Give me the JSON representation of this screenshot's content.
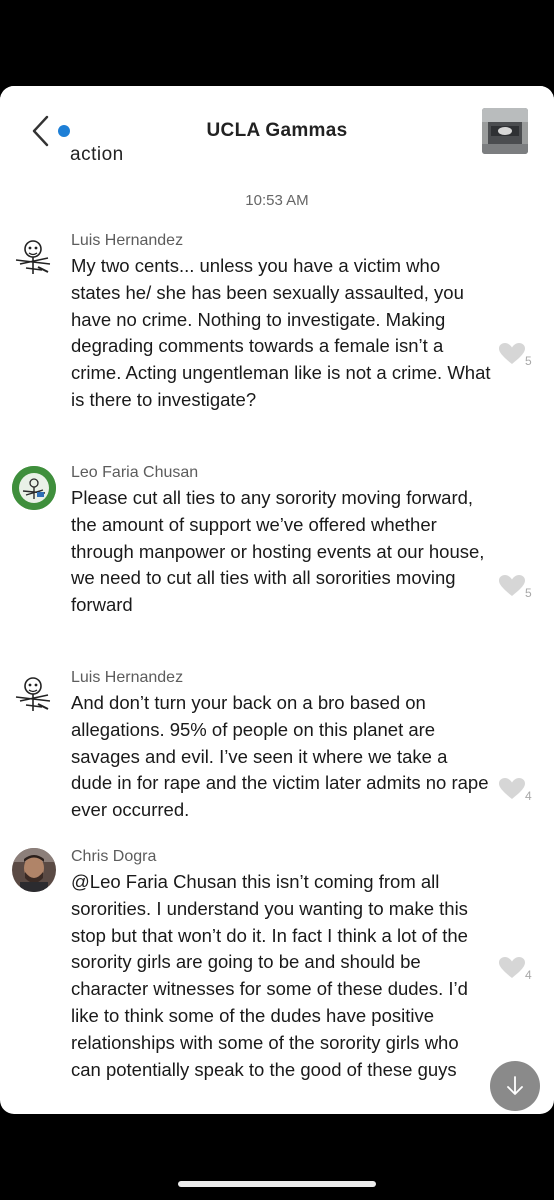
{
  "header": {
    "title": "UCLA Gammas",
    "back_icon": "chevron-left-icon",
    "unread_color": "#1e7fd6",
    "group_avatar": "group-photo"
  },
  "clipped_previous_text": "action",
  "timestamp": "10:53 AM",
  "messages": [
    {
      "sender": "Luis Hernandez",
      "text": "My two cents... unless you have a victim who states he/ she has been sexually assaulted, you have no crime. Nothing to investigate. Making degrading comments towards a female isn’t a crime. Acting ungentleman like is not a crime. What is there to investigate?",
      "likes": "5",
      "avatar": "cartoon-meme-avatar"
    },
    {
      "sender": "Leo Faria Chusan",
      "text": "Please cut all ties to any sorority moving forward, the amount of support we’ve offered whether through manpower or hosting events at our house, we need to cut all ties with all sororities moving forward",
      "likes": "5",
      "avatar": "green-cartoon-avatar"
    },
    {
      "sender": "Luis Hernandez",
      "text": "And don’t turn your back on a bro based on allegations. 95% of people on this planet are savages and evil. I’ve seen it where we take a dude in for rape and the victim later admits no rape ever occurred.",
      "likes": "4",
      "avatar": "cartoon-meme-avatar"
    },
    {
      "sender": "Chris Dogra",
      "text": "@Leo Faria Chusan this isn’t coming from all sororities. I understand you wanting to make this stop but that won’t do it. In fact I think a lot of the sorority girls are going to be and should be character witnesses for some of these dudes. I’d like to think some of the dudes have positive relationships with some of the sorority girls who can potentially speak to the good of these guys",
      "likes": "4",
      "avatar": "profile-photo-avatar"
    }
  ],
  "scroll_button_icon": "arrow-down-icon"
}
